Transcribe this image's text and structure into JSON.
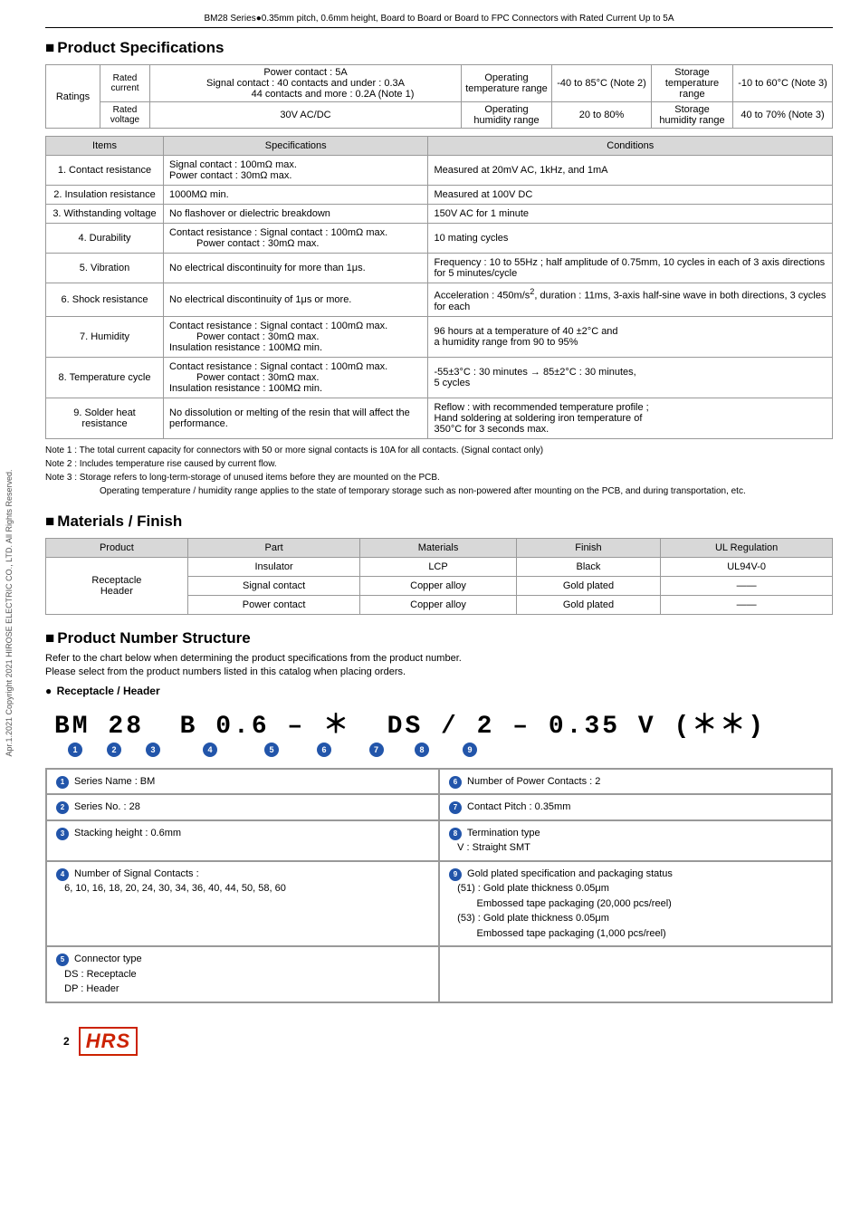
{
  "header": {
    "title": "BM28 Series●0.35mm pitch, 0.6mm height, Board to Board or Board to FPC Connectors with Rated Current Up to 5A"
  },
  "side_text": "Apr.1.2021 Copyright 2021 HIROSE ELECTRIC CO., LTD. All Rights Reserved.",
  "product_specs": {
    "section_title": "Product Specifications",
    "ratings": {
      "rows": [
        {
          "label": "Ratings",
          "sub_label": "Rated current",
          "content": "Power contact : 5A\nSignal contact : 40 contacts and under : 0.3A\n44 contacts and more : 0.2A (Note 1)",
          "col3_label": "Operating temperature range",
          "col3_val": "-40 to 85°C (Note 2)",
          "col4_label": "Storage temperature range",
          "col4_val": "-10 to 60°C (Note 3)"
        },
        {
          "sub_label": "Rated voltage",
          "content": "30V AC/DC",
          "col3_label": "Operating humidity range",
          "col3_val": "20 to 80%",
          "col4_label": "Storage humidity range",
          "col4_val": "40 to 70% (Note 3)"
        }
      ]
    },
    "specs_header": [
      "Items",
      "Specifications",
      "Conditions"
    ],
    "specs_rows": [
      {
        "item": "1. Contact resistance",
        "spec": "Signal contact : 100mΩ max.\nPower contact : 30mΩ max.",
        "cond": "Measured at 20mV AC, 1kHz, and 1mA"
      },
      {
        "item": "2. Insulation resistance",
        "spec": "1000MΩ min.",
        "cond": "Measured at 100V DC"
      },
      {
        "item": "3. Withstanding voltage",
        "spec": "No flashover or dielectric breakdown",
        "cond": "150V AC for 1 minute"
      },
      {
        "item": "4. Durability",
        "spec": "Contact resistance : Signal contact : 100mΩ max.\nPower contact : 30mΩ max.",
        "cond": "10 mating cycles"
      },
      {
        "item": "5. Vibration",
        "spec": "No electrical discontinuity for more than 1μs.",
        "cond": "Frequency : 10 to 55Hz ; half amplitude of 0.75mm, 10 cycles in each of 3 axis directions for 5 minutes/cycle"
      },
      {
        "item": "6. Shock resistance",
        "spec": "No electrical discontinuity of 1μs or more.",
        "cond": "Acceleration : 450m/s², duration : 11ms, 3-axis half-sine wave in both directions, 3 cycles for each"
      },
      {
        "item": "7. Humidity",
        "spec": "Contact resistance : Signal contact : 100mΩ max.\nPower contact : 30mΩ max.\nInsulation resistance : 100MΩ min.",
        "cond": "96 hours at a temperature of 40 ±2°C and a humidity range from 90 to 95%"
      },
      {
        "item": "8. Temperature cycle",
        "spec": "Contact resistance : Signal contact : 100mΩ max.\nPower contact : 30mΩ max.\nInsulation resistance : 100MΩ min.",
        "cond": "-55±3°C : 30 minutes → 85±2°C : 30 minutes, 5 cycles"
      },
      {
        "item": "9. Solder heat resistance",
        "spec": "No dissolution or melting of the resin that will affect the performance.",
        "cond": "Reflow : with recommended temperature profile ; Hand soldering at soldering iron temperature of 350°C for 3 seconds max."
      }
    ],
    "notes": [
      "Note 1 : The total current capacity for connectors with 50 or more signal contacts is 10A for all contacts. (Signal contact only)",
      "Note 2 : Includes temperature rise caused by current flow.",
      "Note 3 : Storage refers to long-term-storage of unused items before they are mounted on the PCB.",
      "          Operating temperature / humidity range applies to the state of temporary storage such as non-powered after mounting on the PCB, and during transportation, etc."
    ]
  },
  "materials_finish": {
    "section_title": "Materials / Finish",
    "headers": [
      "Product",
      "Part",
      "Materials",
      "Finish",
      "UL Regulation"
    ],
    "product_label": "Receptacle Header",
    "rows": [
      {
        "part": "Insulator",
        "materials": "LCP",
        "finish": "Black",
        "ul": "UL94V-0"
      },
      {
        "part": "Signal contact",
        "materials": "Copper alloy",
        "finish": "Gold plated",
        "ul": "——"
      },
      {
        "part": "Power contact",
        "materials": "Copper alloy",
        "finish": "Gold plated",
        "ul": "——"
      }
    ]
  },
  "product_number": {
    "section_title": "Product Number Structure",
    "desc1": "Refer to the chart below when determining the product specifications from the product number.",
    "desc2": "Please select from the product numbers listed in this catalog when placing orders.",
    "sub_title": "Receptacle / Header",
    "part_number": "BM 28 B 0.6 – ＊ DS / 2 – 0.35 V (＊＊)",
    "circles": [
      "①",
      "②",
      "③",
      "④",
      "⑤",
      "⑥",
      "⑦",
      "⑧",
      "⑨"
    ],
    "details": [
      {
        "num": "❶",
        "label": "Series Name : BM"
      },
      {
        "num": "❻",
        "label": "Number of Power Contacts : 2"
      },
      {
        "num": "❷",
        "label": "Series No. : 28"
      },
      {
        "num": "❼",
        "label": "Contact Pitch : 0.35mm"
      },
      {
        "num": "❸",
        "label": "Stacking height : 0.6mm"
      },
      {
        "num": "❽",
        "label": "Termination type\nV : Straight SMT"
      },
      {
        "num": "❹",
        "label": "Number of Signal Contacts :\n6, 10, 16, 18, 20, 24, 30, 34, 36, 40, 44, 50, 58, 60"
      },
      {
        "num": "❾",
        "label": "Gold plated specification and packaging status\n(51) : Gold plate thickness 0.05μm\nEmbossed tape packaging (20,000 pcs/reel)\n(53) : Gold plate thickness 0.05μm\nEmbossed tape packaging (1,000 pcs/reel)"
      },
      {
        "num": "❺",
        "label": "Connector type\nDS : Receptacle\nDP : Header"
      },
      {
        "num": "",
        "label": ""
      }
    ]
  },
  "footer": {
    "page_num": "2",
    "logo": "HRS"
  }
}
